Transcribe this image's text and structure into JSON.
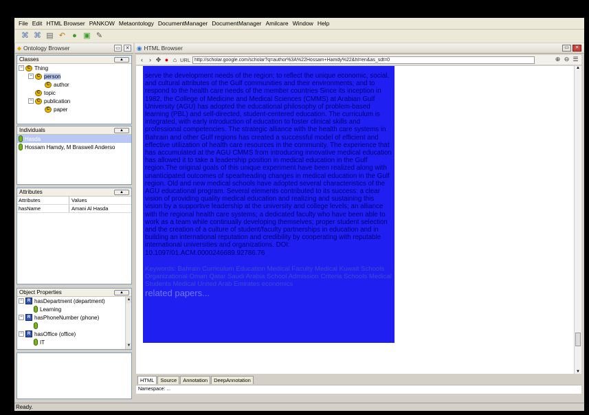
{
  "menu": [
    "File",
    "Edit",
    "HTML Browser",
    "PANKOW",
    "Metaontology",
    "DocumentManager",
    "DocumentManager",
    "Amilcare",
    "Window",
    "Help"
  ],
  "toolbar": {
    "icons": [
      "save-icon",
      "save-all-icon",
      "document-icon",
      "back-arrow-icon",
      "green-circle-icon",
      "green-puzzle-icon",
      "edit-tool-icon"
    ],
    "glyphs": [
      "⌘",
      "⌘",
      "▤",
      "↶",
      "●",
      "▣",
      "✎"
    ]
  },
  "ontology_browser": {
    "title": "Ontology Browser",
    "classes": {
      "header": "Classes",
      "items": [
        {
          "label": "Thing",
          "depth": 0,
          "expander": "−"
        },
        {
          "label": "person",
          "depth": 1,
          "expander": "−"
        },
        {
          "label": "author",
          "depth": 2,
          "expander": ""
        },
        {
          "label": "topic",
          "depth": 1,
          "expander": ""
        },
        {
          "label": "publication",
          "depth": 1,
          "expander": "−"
        },
        {
          "label": "paper",
          "depth": 2,
          "expander": ""
        }
      ]
    },
    "individuals": {
      "header": "Individuals",
      "items": [
        "Hasda",
        "Hossam Hamdy, M Braswell Anderso"
      ]
    },
    "attributes": {
      "header": "Attributes",
      "col_attr": "Attributes",
      "col_val": "Values",
      "rows": [
        {
          "attr": "hasName",
          "value": "Amani Al Hasda"
        }
      ]
    },
    "object_properties": {
      "header": "Object Properties",
      "items": [
        {
          "label": "hasDepartment (department)",
          "type": "prop"
        },
        {
          "label": "Learning",
          "type": "ind"
        },
        {
          "label": "hasPhoneNumber (phone)",
          "type": "prop"
        },
        {
          "label": "",
          "type": "ind"
        },
        {
          "label": "hasOffice (office)",
          "type": "prop"
        },
        {
          "label": "IT",
          "type": "ind"
        }
      ]
    }
  },
  "browser": {
    "title": "HTML Browser",
    "url_label": "URL",
    "url": "http://scholar.google.com/scholar?q=author%3A%22Hossam+Hamdy%22&hl=en&as_sdt=0",
    "abstract": "serve the development needs of the region; to reflect the unique economic, social, and cultural attributes of the Gulf communities and their environments; and to respond to the health care needs of the member countries Since its inception in 1982, the College of Medicine and Medical Sciences (CMMS) at Arabian Gulf University (AGU) has adopted the educational philosophy of problem-based learning (PBL) and self-directed, student-centered education. The curriculum is integrated, with early introduction of education to foster clinical skills and professional competencies. The strategic alliance with the health care systems in Bahrain and other Gulf regions has created a successful model of efficient and effective utilization of health care resources in the community. The experience that has accumulated at the AGU CMMS from introducing innovative medical education has allowed it to take a leadership position in medical education in the Gulf region.The original goals of this unique experiment have been realized along with unanticipated outcomes of spearheading changes in medical education in the Gulf region. Old and new medical schools have adopted several characteristics of the AGU educational program. Several elements contributed to its success: a clear vision of providing quality medical education and realizing and sustaining this vision by a supportive leadership at the university and college levels; an alliance with the regional health care systems; a dedicated faculty who have been able to work as a team while continually developing themselves; proper student selection and the creation of a culture of student/faculty partnerships in education and in building an international reputation and credibility by cooperating with reputable international universities and organizations. DOI: 10.1097/01.ACM.0000246689.92786.76",
    "keywords": "Keywords: Bahrain  Curriculum  Education  Medical  Faculty  Medical  Kuwait  Schools  Organizational  Oman  Qatar  Saudi Arabia  School Admission Criteria  Schools  Medical  Students  Medical  United Arab Emirates  economics",
    "related": "related papers...",
    "tabs": [
      "HTML",
      "Source",
      "Annotation",
      "DeepAnnotation"
    ],
    "namespace": "Namespace: ..."
  },
  "status": "Ready."
}
